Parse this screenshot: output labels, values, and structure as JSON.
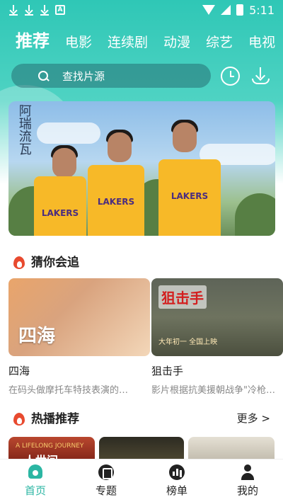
{
  "status_bar": {
    "time": "5:11",
    "notification_icons": [
      "download-icon",
      "download-icon",
      "download-icon",
      "app-a-icon"
    ]
  },
  "nav": {
    "tabs": [
      {
        "label": "推荐",
        "active": true
      },
      {
        "label": "电影",
        "active": false
      },
      {
        "label": "连续剧",
        "active": false
      },
      {
        "label": "动漫",
        "active": false
      },
      {
        "label": "综艺",
        "active": false
      },
      {
        "label": "电视",
        "active": false
      }
    ]
  },
  "search": {
    "placeholder": "查找片源"
  },
  "banner": {
    "calligraphy": "阿瑞流瓦",
    "jersey_text": "LAKERS"
  },
  "section_guess": {
    "title": "猜你会追"
  },
  "cards": [
    {
      "title": "四海",
      "desc": "在码头做摩托车特技表演的…",
      "poster_text": "四海"
    },
    {
      "title": "狙击手",
      "desc": "影片根据抗美援朝战争\"冷枪…",
      "poster_text": "狙击手",
      "poster_caption": "大年初一 全国上映"
    }
  ],
  "section_hot": {
    "title": "热播推荐",
    "more_label": "更多 >"
  },
  "hot_strips": [
    {
      "caption": "A LIFELONG JOURNEY",
      "title": "人世间"
    },
    {
      "caption": ""
    },
    {
      "caption": ""
    }
  ],
  "tab_bar": {
    "items": [
      {
        "label": "首页",
        "active": true,
        "icon": "home-icon"
      },
      {
        "label": "专题",
        "active": false,
        "icon": "topic-icon"
      },
      {
        "label": "榜单",
        "active": false,
        "icon": "rank-icon"
      },
      {
        "label": "我的",
        "active": false,
        "icon": "user-icon"
      }
    ]
  },
  "colors": {
    "accent": "#2bb6a3",
    "header_gradient_top": "#2fc7b6",
    "fire": "#e84a2f"
  }
}
